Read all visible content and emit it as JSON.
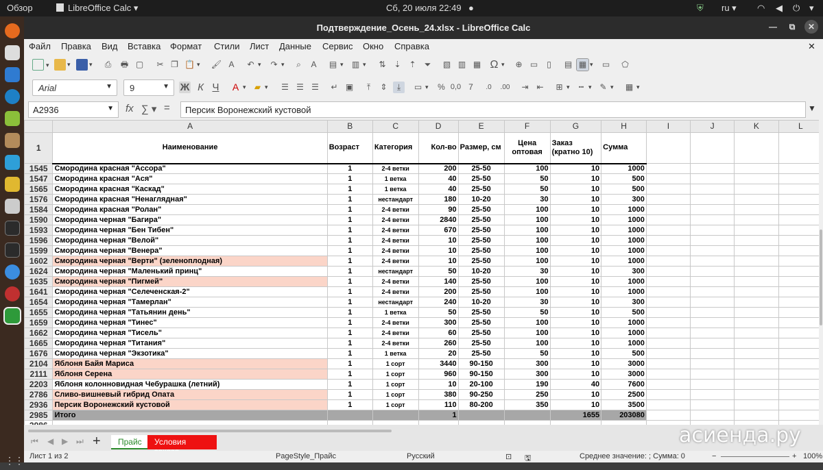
{
  "system": {
    "activities": "Обзор",
    "app_name": "LibreOffice Calc",
    "datetime": "Сб, 20 июля  22:49",
    "lang": "ru"
  },
  "window": {
    "title": "Подтверждение_Осень_24.xlsx - LibreOffice Calc"
  },
  "menu": [
    "Файл",
    "Правка",
    "Вид",
    "Вставка",
    "Формат",
    "Стили",
    "Лист",
    "Данные",
    "Сервис",
    "Окно",
    "Справка"
  ],
  "font": {
    "name": "Arial",
    "size": "9"
  },
  "namebox": "A2936",
  "formula": "Персик Воронежский кустовой",
  "columns": [
    "A",
    "B",
    "C",
    "D",
    "E",
    "F",
    "G",
    "H",
    "I",
    "J",
    "K",
    "L"
  ],
  "header_row": {
    "num": "1",
    "cells": [
      "Наименование",
      "Возраст",
      "Категория",
      "Кол-во",
      "Размер, см",
      "Цена\nоптовая",
      "Заказ\n(кратно 10)",
      "Сумма"
    ]
  },
  "rows": [
    {
      "n": "1545",
      "name": "Смородина красная \"Ассора\"",
      "age": "1",
      "cat": "2-4 ветки",
      "qty": "200",
      "size": "25-50",
      "price": "100",
      "order": "10",
      "sum": "1000",
      "hl": false
    },
    {
      "n": "1547",
      "name": "Смородина красная \"Ася\"",
      "age": "1",
      "cat": "1 ветка",
      "qty": "40",
      "size": "25-50",
      "price": "50",
      "order": "10",
      "sum": "500",
      "hl": false
    },
    {
      "n": "1565",
      "name": "Смородина красная \"Каскад\"",
      "age": "1",
      "cat": "1 ветка",
      "qty": "40",
      "size": "25-50",
      "price": "50",
      "order": "10",
      "sum": "500",
      "hl": false
    },
    {
      "n": "1576",
      "name": "Смородина красная \"Ненаглядная\"",
      "age": "1",
      "cat": "нестандарт",
      "qty": "180",
      "size": "10-20",
      "price": "30",
      "order": "10",
      "sum": "300",
      "hl": false
    },
    {
      "n": "1584",
      "name": "Смородина красная \"Ролан\"",
      "age": "1",
      "cat": "2-4 ветки",
      "qty": "90",
      "size": "25-50",
      "price": "100",
      "order": "10",
      "sum": "1000",
      "hl": false
    },
    {
      "n": "1590",
      "name": "Смородина черная \"Багира\"",
      "age": "1",
      "cat": "2-4 ветки",
      "qty": "2840",
      "size": "25-50",
      "price": "100",
      "order": "10",
      "sum": "1000",
      "hl": false
    },
    {
      "n": "1593",
      "name": "Смородина черная \"Бен Тибен\"",
      "age": "1",
      "cat": "2-4 ветки",
      "qty": "670",
      "size": "25-50",
      "price": "100",
      "order": "10",
      "sum": "1000",
      "hl": false
    },
    {
      "n": "1596",
      "name": "Смородина черная \"Велой\"",
      "age": "1",
      "cat": "2-4 ветки",
      "qty": "10",
      "size": "25-50",
      "price": "100",
      "order": "10",
      "sum": "1000",
      "hl": false
    },
    {
      "n": "1599",
      "name": "Смородина черная \"Венера\"",
      "age": "1",
      "cat": "2-4 ветки",
      "qty": "10",
      "size": "25-50",
      "price": "100",
      "order": "10",
      "sum": "1000",
      "hl": false
    },
    {
      "n": "1602",
      "name": "Смородина черная \"Верти\" (зеленоплодная)",
      "age": "1",
      "cat": "2-4 ветки",
      "qty": "10",
      "size": "25-50",
      "price": "100",
      "order": "10",
      "sum": "1000",
      "hl": true
    },
    {
      "n": "1624",
      "name": "Смородина черная \"Маленький принц\"",
      "age": "1",
      "cat": "нестандарт",
      "qty": "50",
      "size": "10-20",
      "price": "30",
      "order": "10",
      "sum": "300",
      "hl": false
    },
    {
      "n": "1635",
      "name": "Смородина черная \"Пигмей\"",
      "age": "1",
      "cat": "2-4 ветки",
      "qty": "140",
      "size": "25-50",
      "price": "100",
      "order": "10",
      "sum": "1000",
      "hl": true
    },
    {
      "n": "1641",
      "name": "Смородина черная \"Селеченская-2\"",
      "age": "1",
      "cat": "2-4 ветки",
      "qty": "200",
      "size": "25-50",
      "price": "100",
      "order": "10",
      "sum": "1000",
      "hl": false
    },
    {
      "n": "1654",
      "name": "Смородина черная \"Тамерлан\"",
      "age": "1",
      "cat": "нестандарт",
      "qty": "240",
      "size": "10-20",
      "price": "30",
      "order": "10",
      "sum": "300",
      "hl": false
    },
    {
      "n": "1655",
      "name": "Смородина черная \"Татьянин день\"",
      "age": "1",
      "cat": "1 ветка",
      "qty": "50",
      "size": "25-50",
      "price": "50",
      "order": "10",
      "sum": "500",
      "hl": false
    },
    {
      "n": "1659",
      "name": "Смородина черная \"Тинес\"",
      "age": "1",
      "cat": "2-4 ветки",
      "qty": "300",
      "size": "25-50",
      "price": "100",
      "order": "10",
      "sum": "1000",
      "hl": false
    },
    {
      "n": "1662",
      "name": "Смородина черная \"Тисель\"",
      "age": "1",
      "cat": "2-4 ветки",
      "qty": "60",
      "size": "25-50",
      "price": "100",
      "order": "10",
      "sum": "1000",
      "hl": false
    },
    {
      "n": "1665",
      "name": "Смородина черная \"Титания\"",
      "age": "1",
      "cat": "2-4 ветки",
      "qty": "260",
      "size": "25-50",
      "price": "100",
      "order": "10",
      "sum": "1000",
      "hl": false
    },
    {
      "n": "1676",
      "name": "Смородина черная \"Экзотика\"",
      "age": "1",
      "cat": "1 ветка",
      "qty": "20",
      "size": "25-50",
      "price": "50",
      "order": "10",
      "sum": "500",
      "hl": false
    },
    {
      "n": "2104",
      "name": "Яблоня Байя Мариса",
      "age": "1",
      "cat": "1 сорт",
      "qty": "3440",
      "size": "90-150",
      "price": "300",
      "order": "10",
      "sum": "3000",
      "hl": true
    },
    {
      "n": "2111",
      "name": "Яблоня Серена",
      "age": "1",
      "cat": "1 сорт",
      "qty": "960",
      "size": "90-150",
      "price": "300",
      "order": "10",
      "sum": "3000",
      "hl": true
    },
    {
      "n": "2203",
      "name": "Яблоня колонновидная Чебурашка (летний)",
      "age": "1",
      "cat": "1 сорт",
      "qty": "10",
      "size": "20-100",
      "price": "190",
      "order": "40",
      "sum": "7600",
      "hl": false
    },
    {
      "n": "2786",
      "name": "Сливо-вишневый гибрид Опата",
      "age": "1",
      "cat": "1 сорт",
      "qty": "380",
      "size": "90-250",
      "price": "250",
      "order": "10",
      "sum": "2500",
      "hl": true
    },
    {
      "n": "2936",
      "name": "Персик Воронежский кустовой",
      "age": "1",
      "cat": "1 сорт",
      "qty": "110",
      "size": "80-200",
      "price": "350",
      "order": "10",
      "sum": "3500",
      "hl": true
    }
  ],
  "total_row": {
    "n": "2985",
    "label": "Итого",
    "qty": "1",
    "order": "1655",
    "sum": "203080"
  },
  "last_row": {
    "n": "2986"
  },
  "sheets": {
    "tab1": "Прайс",
    "tab2": "Условия заказа"
  },
  "status": {
    "sheet_of": "Лист 1 из 2",
    "page_style": "PageStyle_Прайс",
    "language": "Русский",
    "summary": "Среднее значение: ; Сумма: 0",
    "zoom": "100%"
  },
  "watermark": "асиенда.ру",
  "colors": {
    "highlight": "#fbd5c8",
    "total": "#a7a7a7",
    "sheet_tab2": "#ee1111"
  }
}
